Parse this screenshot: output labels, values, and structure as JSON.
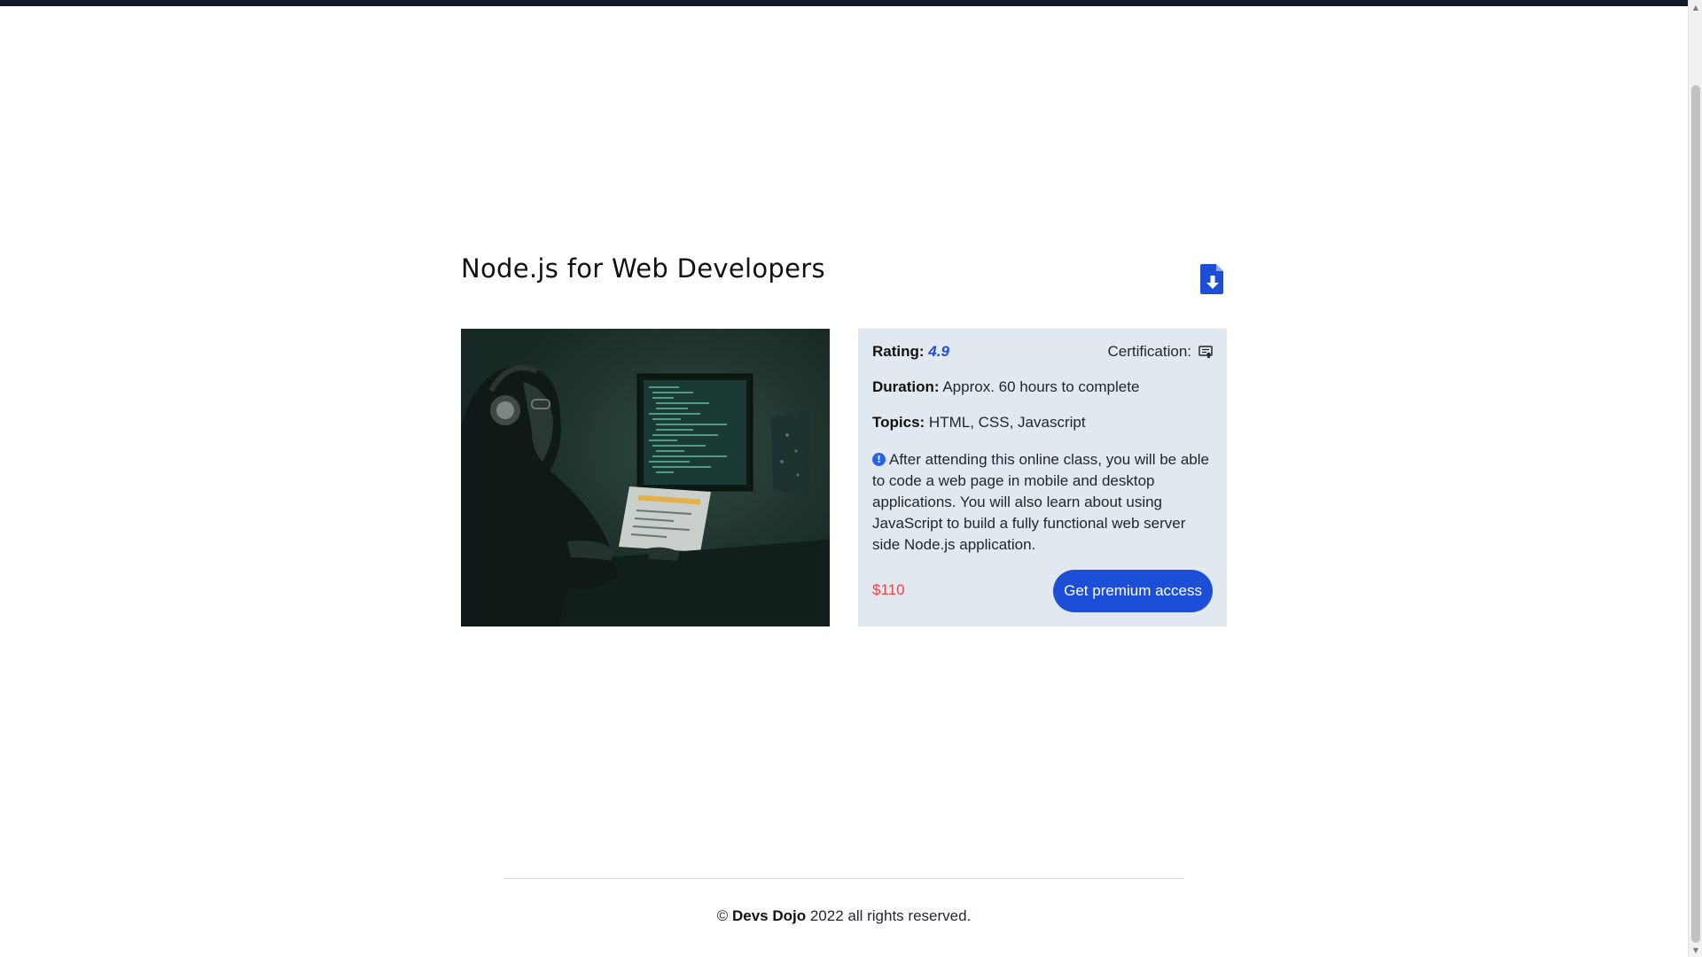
{
  "page": {
    "title": "Node.js for Web Developers"
  },
  "icons": {
    "download": "file-download-icon",
    "certification": "certificate-icon",
    "info": "info-icon"
  },
  "colors": {
    "accent": "#1d4ed8",
    "panel_bg": "#e2e8f0",
    "price": "#ef4444",
    "topbar": "#111827"
  },
  "course": {
    "image_alt": "Developer wearing headphones coding at a desk with monitors",
    "rating_label": "Rating:",
    "rating_value": "4.9",
    "certification_label": "Certification:",
    "duration_label": "Duration:",
    "duration_value": "Approx. 60 hours to complete",
    "topics_label": "Topics:",
    "topics_value": "HTML, CSS, Javascript",
    "info_glyph": "!",
    "description": "After attending this online class, you will be able to code a web page in mobile and desktop applications. You will also learn about using JavaScript to build a fully functional web server side Node.js application.",
    "price": "$110",
    "cta_label": "Get premium access"
  },
  "footer": {
    "copyright_symbol": "©",
    "brand": "Devs Dojo",
    "suffix": "2022 all rights reserved."
  },
  "scrollbar": {
    "up_arrow": "▲",
    "down_arrow": "▼"
  }
}
